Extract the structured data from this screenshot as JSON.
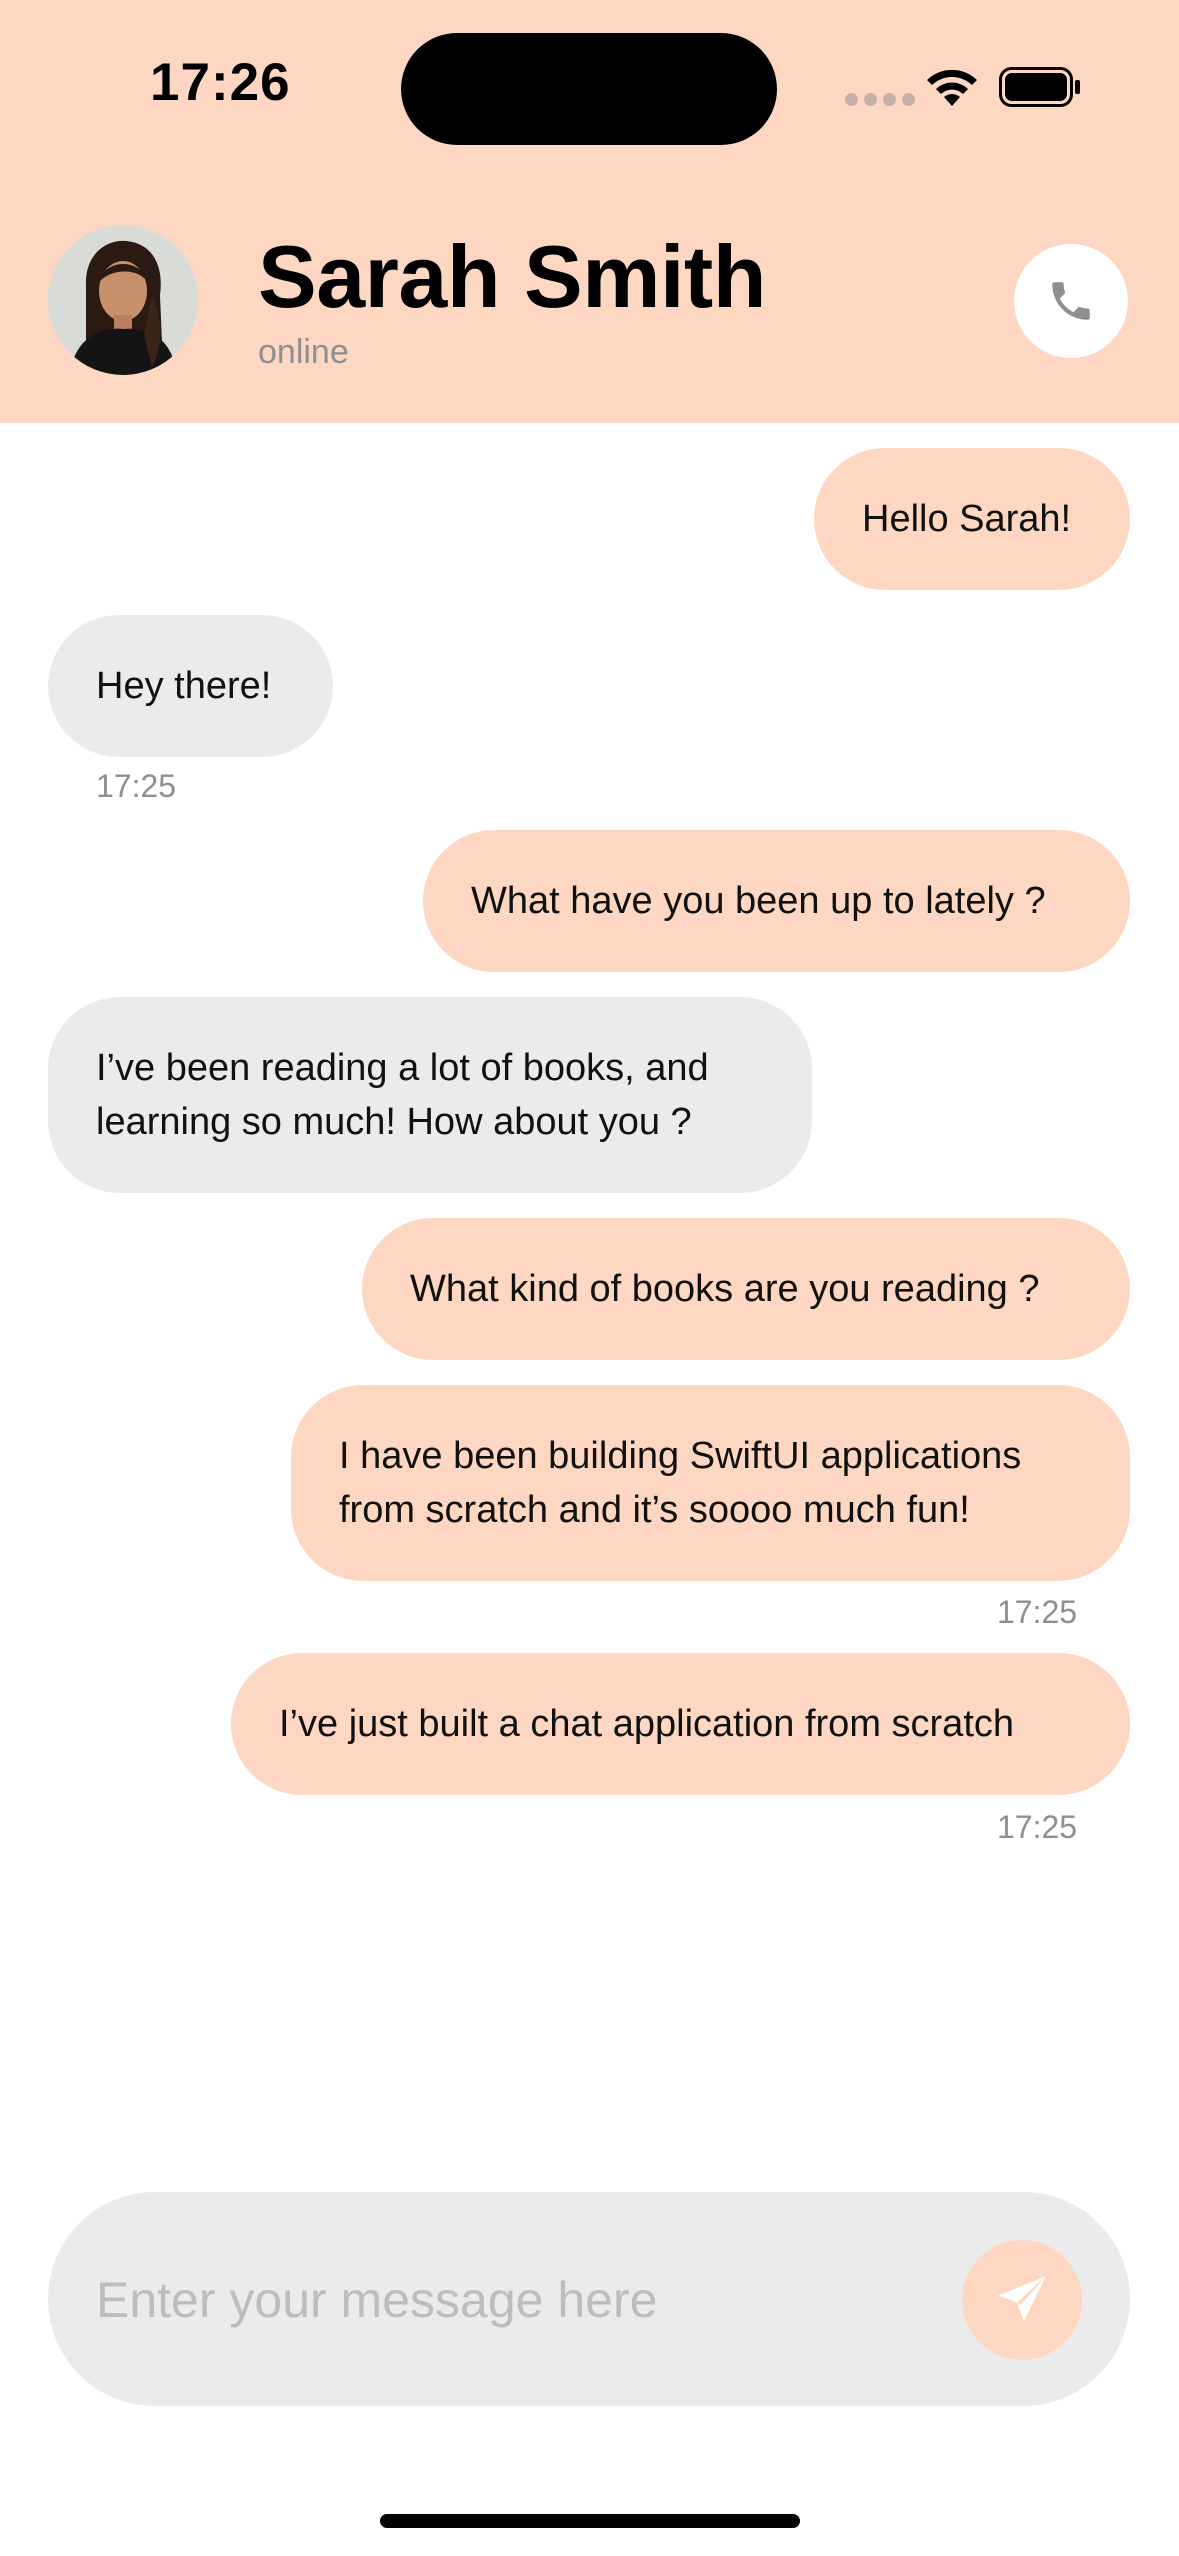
{
  "status_bar": {
    "time": "17:26"
  },
  "header": {
    "name": "Sarah Smith",
    "status": "online",
    "background": "#fed7c3"
  },
  "messages": [
    {
      "direction": "outgoing",
      "text": "Hello Sarah!"
    },
    {
      "direction": "incoming",
      "text": "Hey there!",
      "time": "17:25"
    },
    {
      "direction": "outgoing",
      "text": "What have you been up to lately ?"
    },
    {
      "direction": "incoming",
      "lines": [
        "I’ve been reading a lot of books, and",
        "learning so much! How about you ?"
      ]
    },
    {
      "direction": "outgoing",
      "text": "What kind of books are you reading ?"
    },
    {
      "direction": "outgoing",
      "lines": [
        "I have been building SwiftUI applications",
        "from scratch and it’s soooo much fun!"
      ],
      "time": "17:25"
    },
    {
      "direction": "outgoing",
      "text": "I’ve just built a chat application from scratch",
      "time": "17:25"
    }
  ],
  "composer": {
    "placeholder": "Enter your message here"
  },
  "icons": {
    "call": "phone-icon",
    "send": "paper-plane-icon",
    "wifi": "wifi-icon",
    "battery": "battery-icon"
  },
  "colors": {
    "accent": "#fed7c3",
    "incoming_bubble": "#ebebeb",
    "muted_text": "#8e8e93"
  }
}
